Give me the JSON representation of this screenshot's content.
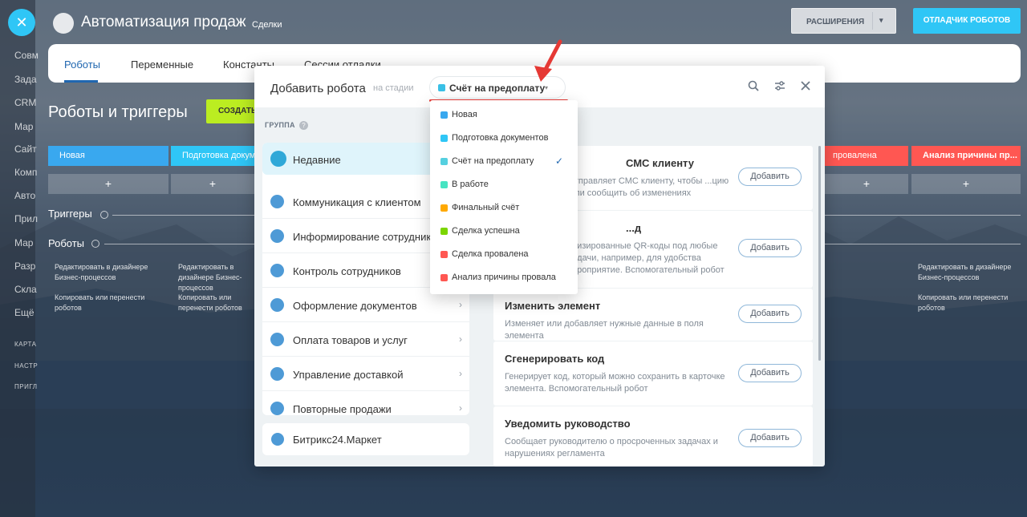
{
  "app": {
    "title": "Автоматизация продаж",
    "subtitle": "Сделки",
    "extensions_button": "РАСШИРЕНИЯ",
    "debugger_button": "ОТЛАДЧИК РОБОТОВ"
  },
  "sidebar": {
    "items": [
      "Совм",
      "Зада",
      "CRM",
      "Мар",
      "Сайт",
      "Комп",
      "Авто",
      "Прил",
      "Мар",
      "Разр",
      "Скла",
      "Ещё"
    ],
    "small_items": [
      "КАРТА",
      "НАСТР",
      "ПРИГЛ"
    ]
  },
  "tabs": [
    {
      "label": "Роботы"
    },
    {
      "label": "Переменные"
    },
    {
      "label": "Константы"
    },
    {
      "label": "Сессии отладки"
    }
  ],
  "board": {
    "title": "Роботы и триггеры",
    "create_button": "СОЗДАТЬ",
    "triggers_label": "Триггеры",
    "robots_label": "Роботы",
    "stages": [
      {
        "label": "Новая",
        "color": "#39a8ef"
      },
      {
        "label": "Подготовка докум",
        "color": "#2fc6f6"
      },
      {
        "label": "провалена",
        "color": "#ff5752"
      },
      {
        "label": "Анализ причины пр...",
        "color": "#ff5752"
      }
    ],
    "plus": "+",
    "robot_texts": {
      "edit": "Редактировать в дизайнере Бизнес-процессов",
      "copy": "Копировать или перенести роботов",
      "edit_partial": "Редактировать в дизайнере Бизнес-процессов"
    }
  },
  "modal": {
    "title": "Добавить робота",
    "stage_label": "на стадии",
    "selected_stage": "Счёт на предоплату",
    "group_label": "ГРУППА",
    "groups": [
      {
        "label": "Недавние",
        "icon": "history-icon"
      },
      {
        "label": "Коммуникация с клиентом",
        "icon": "chat-icon"
      },
      {
        "label": "Информирование сотрудников",
        "icon": "info-icon"
      },
      {
        "label": "Контроль сотрудников",
        "icon": "people-icon"
      },
      {
        "label": "Оформление документов",
        "icon": "document-icon"
      },
      {
        "label": "Оплата товаров и услуг",
        "icon": "wallet-icon"
      },
      {
        "label": "Управление доставкой",
        "icon": "truck-icon"
      },
      {
        "label": "Повторные продажи",
        "icon": "repeat-sales-icon"
      }
    ],
    "market": "Битрикс24.Маркет",
    "robots": [
      {
        "title": "СМС клиенту",
        "desc": "отправляет СМС клиенту, чтобы ...цию или сообщить об изменениях",
        "add": "Добавить"
      },
      {
        "title": "...д",
        "desc": "...изированные QR-коды под любые ...дачи, например, для удобства ...роприятие. Вспомогательный робот",
        "add": "Добавить"
      },
      {
        "title": "Изменить элемент",
        "desc": "Изменяет или добавляет нужные данные в поля элемента",
        "add": "Добавить"
      },
      {
        "title": "Сгенерировать код",
        "desc": "Генерирует код, который можно сохранить в карточке элемента. Вспомогательный робот",
        "add": "Добавить"
      },
      {
        "title": "Уведомить руководство",
        "desc": "Сообщает руководителю о просроченных задачах и нарушениях регламента",
        "add": "Добавить"
      }
    ]
  },
  "dropdown": {
    "items": [
      {
        "label": "Новая",
        "color": "#39a8ef",
        "checked": false
      },
      {
        "label": "Подготовка документов",
        "color": "#2fc6f6",
        "checked": false
      },
      {
        "label": "Счёт на предоплату",
        "color": "#55d0e0",
        "checked": true
      },
      {
        "label": "В работе",
        "color": "#47e4c2",
        "checked": false
      },
      {
        "label": "Финальный счёт",
        "color": "#ffa900",
        "checked": false
      },
      {
        "label": "Сделка успешна",
        "color": "#7bd500",
        "checked": false
      },
      {
        "label": "Сделка провалена",
        "color": "#ff5752",
        "checked": false
      },
      {
        "label": "Анализ причины провала",
        "color": "#ff5752",
        "checked": false
      }
    ],
    "checkmark": "✓"
  },
  "colors": {
    "accent": "#2fc6f6",
    "annotation_red": "#e53935",
    "create_green": "#bbed21"
  }
}
